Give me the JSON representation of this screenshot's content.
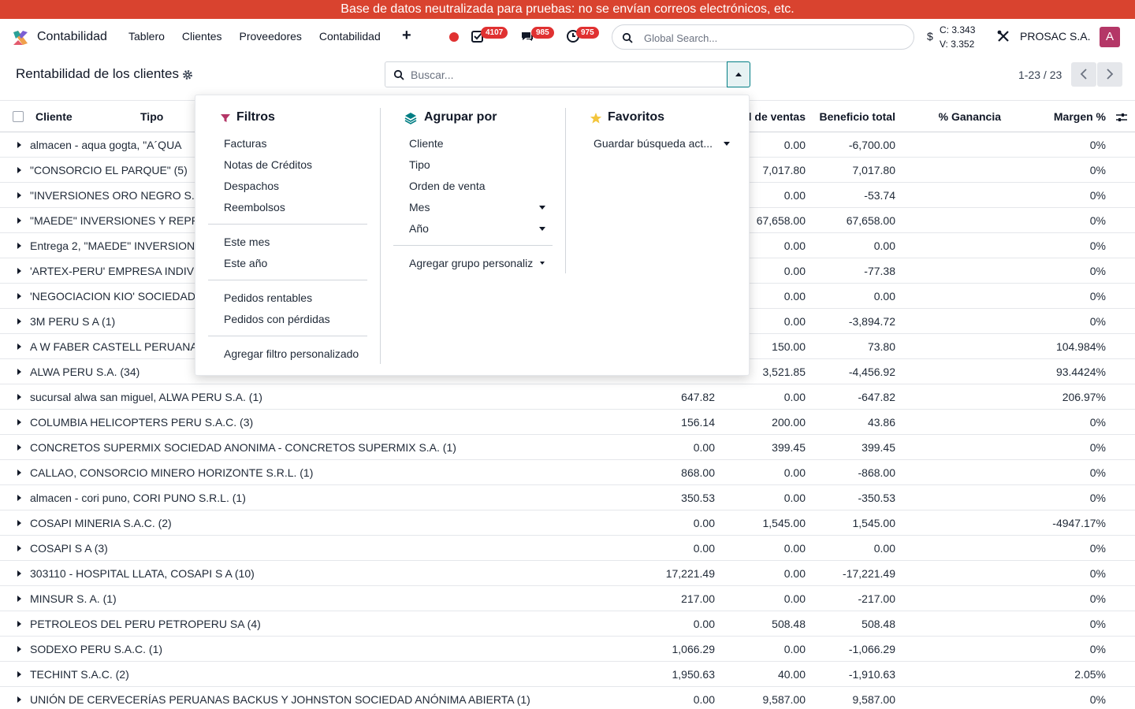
{
  "banner": "Base de datos neutralizada para pruebas: no se envían correos electrónicos, etc.",
  "navbar": {
    "app_name": "Contabilidad",
    "menu": [
      "Tablero",
      "Clientes",
      "Proveedores",
      "Contabilidad"
    ],
    "badges": {
      "activities": "4107",
      "messages": "985",
      "timers": "975"
    },
    "search_placeholder": "Global Search...",
    "currency_symbol": "$",
    "rate_buy": "C: 3.343",
    "rate_sell": "V: 3.352",
    "company": "PROSAC S.A.",
    "avatar_letter": "A"
  },
  "control_panel": {
    "title": "Rentabilidad de los clientes",
    "search_placeholder": "Buscar...",
    "pager": "1-23 / 23"
  },
  "columns": {
    "client": "Cliente",
    "type": "Tipo",
    "sales_total": "l de ventas",
    "profit_total": "Beneficio total",
    "gain_pct": "% Ganancia",
    "margin_pct": "Margen %"
  },
  "rows": [
    {
      "name": "almacen - aqua gogta, \"A´QUA",
      "cost": "",
      "sales": "0.00",
      "profit": "-6,700.00",
      "margin": "0%"
    },
    {
      "name": "\"CONSORCIO EL PARQUE\" (5)",
      "cost": "",
      "sales": "7,017.80",
      "profit": "7,017.80",
      "margin": "0%"
    },
    {
      "name": "\"INVERSIONES ORO NEGRO S.A",
      "cost": "",
      "sales": "0.00",
      "profit": "-53.74",
      "margin": "0%"
    },
    {
      "name": "\"MAEDE\" INVERSIONES Y REPR",
      "cost": "",
      "sales": "67,658.00",
      "profit": "67,658.00",
      "margin": "0%"
    },
    {
      "name": "Entrega 2, \"MAEDE\" INVERSION",
      "cost": "",
      "sales": "0.00",
      "profit": "0.00",
      "margin": "0%"
    },
    {
      "name": "'ARTEX-PERU' EMPRESA INDIVI",
      "cost": "",
      "sales": "0.00",
      "profit": "-77.38",
      "margin": "0%"
    },
    {
      "name": "'NEGOCIACION KIO' SOCIEDAD",
      "cost": "",
      "sales": "0.00",
      "profit": "0.00",
      "margin": "0%"
    },
    {
      "name": "3M PERU S A (1)",
      "cost": "",
      "sales": "0.00",
      "profit": "-3,894.72",
      "margin": "0%"
    },
    {
      "name": "A W FABER CASTELL PERUANA",
      "cost": "",
      "sales": "150.00",
      "profit": "73.80",
      "margin": "104.984%"
    },
    {
      "name": "ALWA PERU S.A. (34)",
      "cost": "",
      "sales": "3,521.85",
      "profit": "-4,456.92",
      "margin": "93.4424%"
    },
    {
      "name": "sucursal alwa san miguel, ALWA PERU S.A. (1)",
      "cost": "647.82",
      "sales": "0.00",
      "profit": "-647.82",
      "margin": "206.97%"
    },
    {
      "name": "COLUMBIA HELICOPTERS PERU S.A.C. (3)",
      "cost": "156.14",
      "sales": "200.00",
      "profit": "43.86",
      "margin": "0%"
    },
    {
      "name": "CONCRETOS SUPERMIX SOCIEDAD ANONIMA - CONCRETOS SUPERMIX S.A. (1)",
      "cost": "0.00",
      "sales": "399.45",
      "profit": "399.45",
      "margin": "0%"
    },
    {
      "name": "CALLAO, CONSORCIO MINERO HORIZONTE S.R.L. (1)",
      "cost": "868.00",
      "sales": "0.00",
      "profit": "-868.00",
      "margin": "0%"
    },
    {
      "name": "almacen - cori puno, CORI PUNO S.R.L. (1)",
      "cost": "350.53",
      "sales": "0.00",
      "profit": "-350.53",
      "margin": "0%"
    },
    {
      "name": "COSAPI MINERIA S.A.C. (2)",
      "cost": "0.00",
      "sales": "1,545.00",
      "profit": "1,545.00",
      "margin": "-4947.17%"
    },
    {
      "name": "COSAPI S A (3)",
      "cost": "0.00",
      "sales": "0.00",
      "profit": "0.00",
      "margin": "0%"
    },
    {
      "name": "303110 - HOSPITAL LLATA, COSAPI S A (10)",
      "cost": "17,221.49",
      "sales": "0.00",
      "profit": "-17,221.49",
      "margin": "0%"
    },
    {
      "name": "MINSUR S. A. (1)",
      "cost": "217.00",
      "sales": "0.00",
      "profit": "-217.00",
      "margin": "0%"
    },
    {
      "name": "PETROLEOS DEL PERU PETROPERU SA (4)",
      "cost": "0.00",
      "sales": "508.48",
      "profit": "508.48",
      "margin": "0%"
    },
    {
      "name": "SODEXO PERU S.A.C. (1)",
      "cost": "1,066.29",
      "sales": "0.00",
      "profit": "-1,066.29",
      "margin": "0%"
    },
    {
      "name": "TECHINT S.A.C. (2)",
      "cost": "1,950.63",
      "sales": "40.00",
      "profit": "-1,910.63",
      "margin": "2.05%"
    },
    {
      "name": "UNIÓN DE CERVECERÍAS PERUANAS BACKUS Y JOHNSTON SOCIEDAD ANÓNIMA ABIERTA (1)",
      "cost": "0.00",
      "sales": "9,587.00",
      "profit": "9,587.00",
      "margin": "0%"
    }
  ],
  "search_panel": {
    "filters": {
      "title": "Filtros",
      "group1": [
        "Facturas",
        "Notas de Créditos",
        "Despachos",
        "Reembolsos"
      ],
      "group2": [
        "Este mes",
        "Este año"
      ],
      "group3": [
        "Pedidos rentables",
        "Pedidos con pérdidas"
      ],
      "custom": "Agregar filtro personalizado"
    },
    "group_by": {
      "title": "Agrupar por",
      "items": [
        "Cliente",
        "Tipo",
        "Orden de venta",
        "Mes",
        "Año"
      ],
      "custom": "Agregar grupo personaliz"
    },
    "favorites": {
      "title": "Favoritos",
      "save": "Guardar búsqueda act..."
    }
  }
}
